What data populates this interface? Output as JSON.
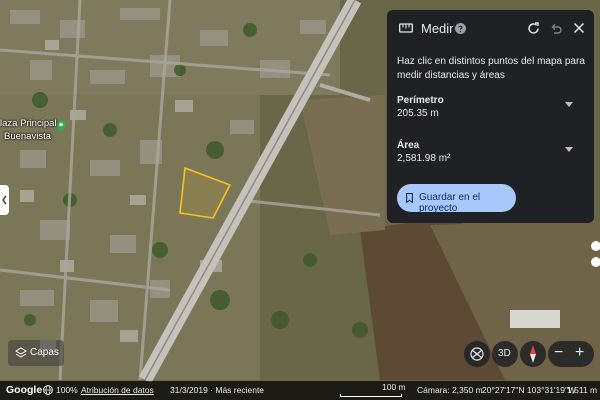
{
  "map": {
    "place_label_line1": "laza Principal",
    "place_label_line2": "Buenavista",
    "layers_label": "Capas",
    "view_3d_label": "3D",
    "zoom_out_label": "−",
    "zoom_in_label": "+",
    "measured_area_color": "#f9c21a",
    "road_color": "#bdbdb6"
  },
  "panel": {
    "title": "Medir",
    "description": "Haz clic en distintos puntos del mapa para medir distancias y áreas",
    "perimeter_label": "Perímetro",
    "perimeter_value": "205.35 m",
    "area_label": "Área",
    "area_value": "2,581.98 m²",
    "save_label": "Guardar en el proyecto",
    "accent": "#a8c7fa",
    "icons": [
      "ruler-icon",
      "help-icon",
      "refresh-icon",
      "undo-icon",
      "close-icon",
      "chevron-down-icon",
      "bookmark-icon"
    ]
  },
  "bottom_bar": {
    "logo": "Google",
    "zoom_percent": "100%",
    "attribution": "Atribución de datos",
    "date": "31/3/2019 · Más reciente",
    "scale": "100 m",
    "camera": "Cámara: 2,350 m",
    "coordinates": "20°27'17\"N 103°31'19\"W",
    "elevation": "1,511 m"
  }
}
